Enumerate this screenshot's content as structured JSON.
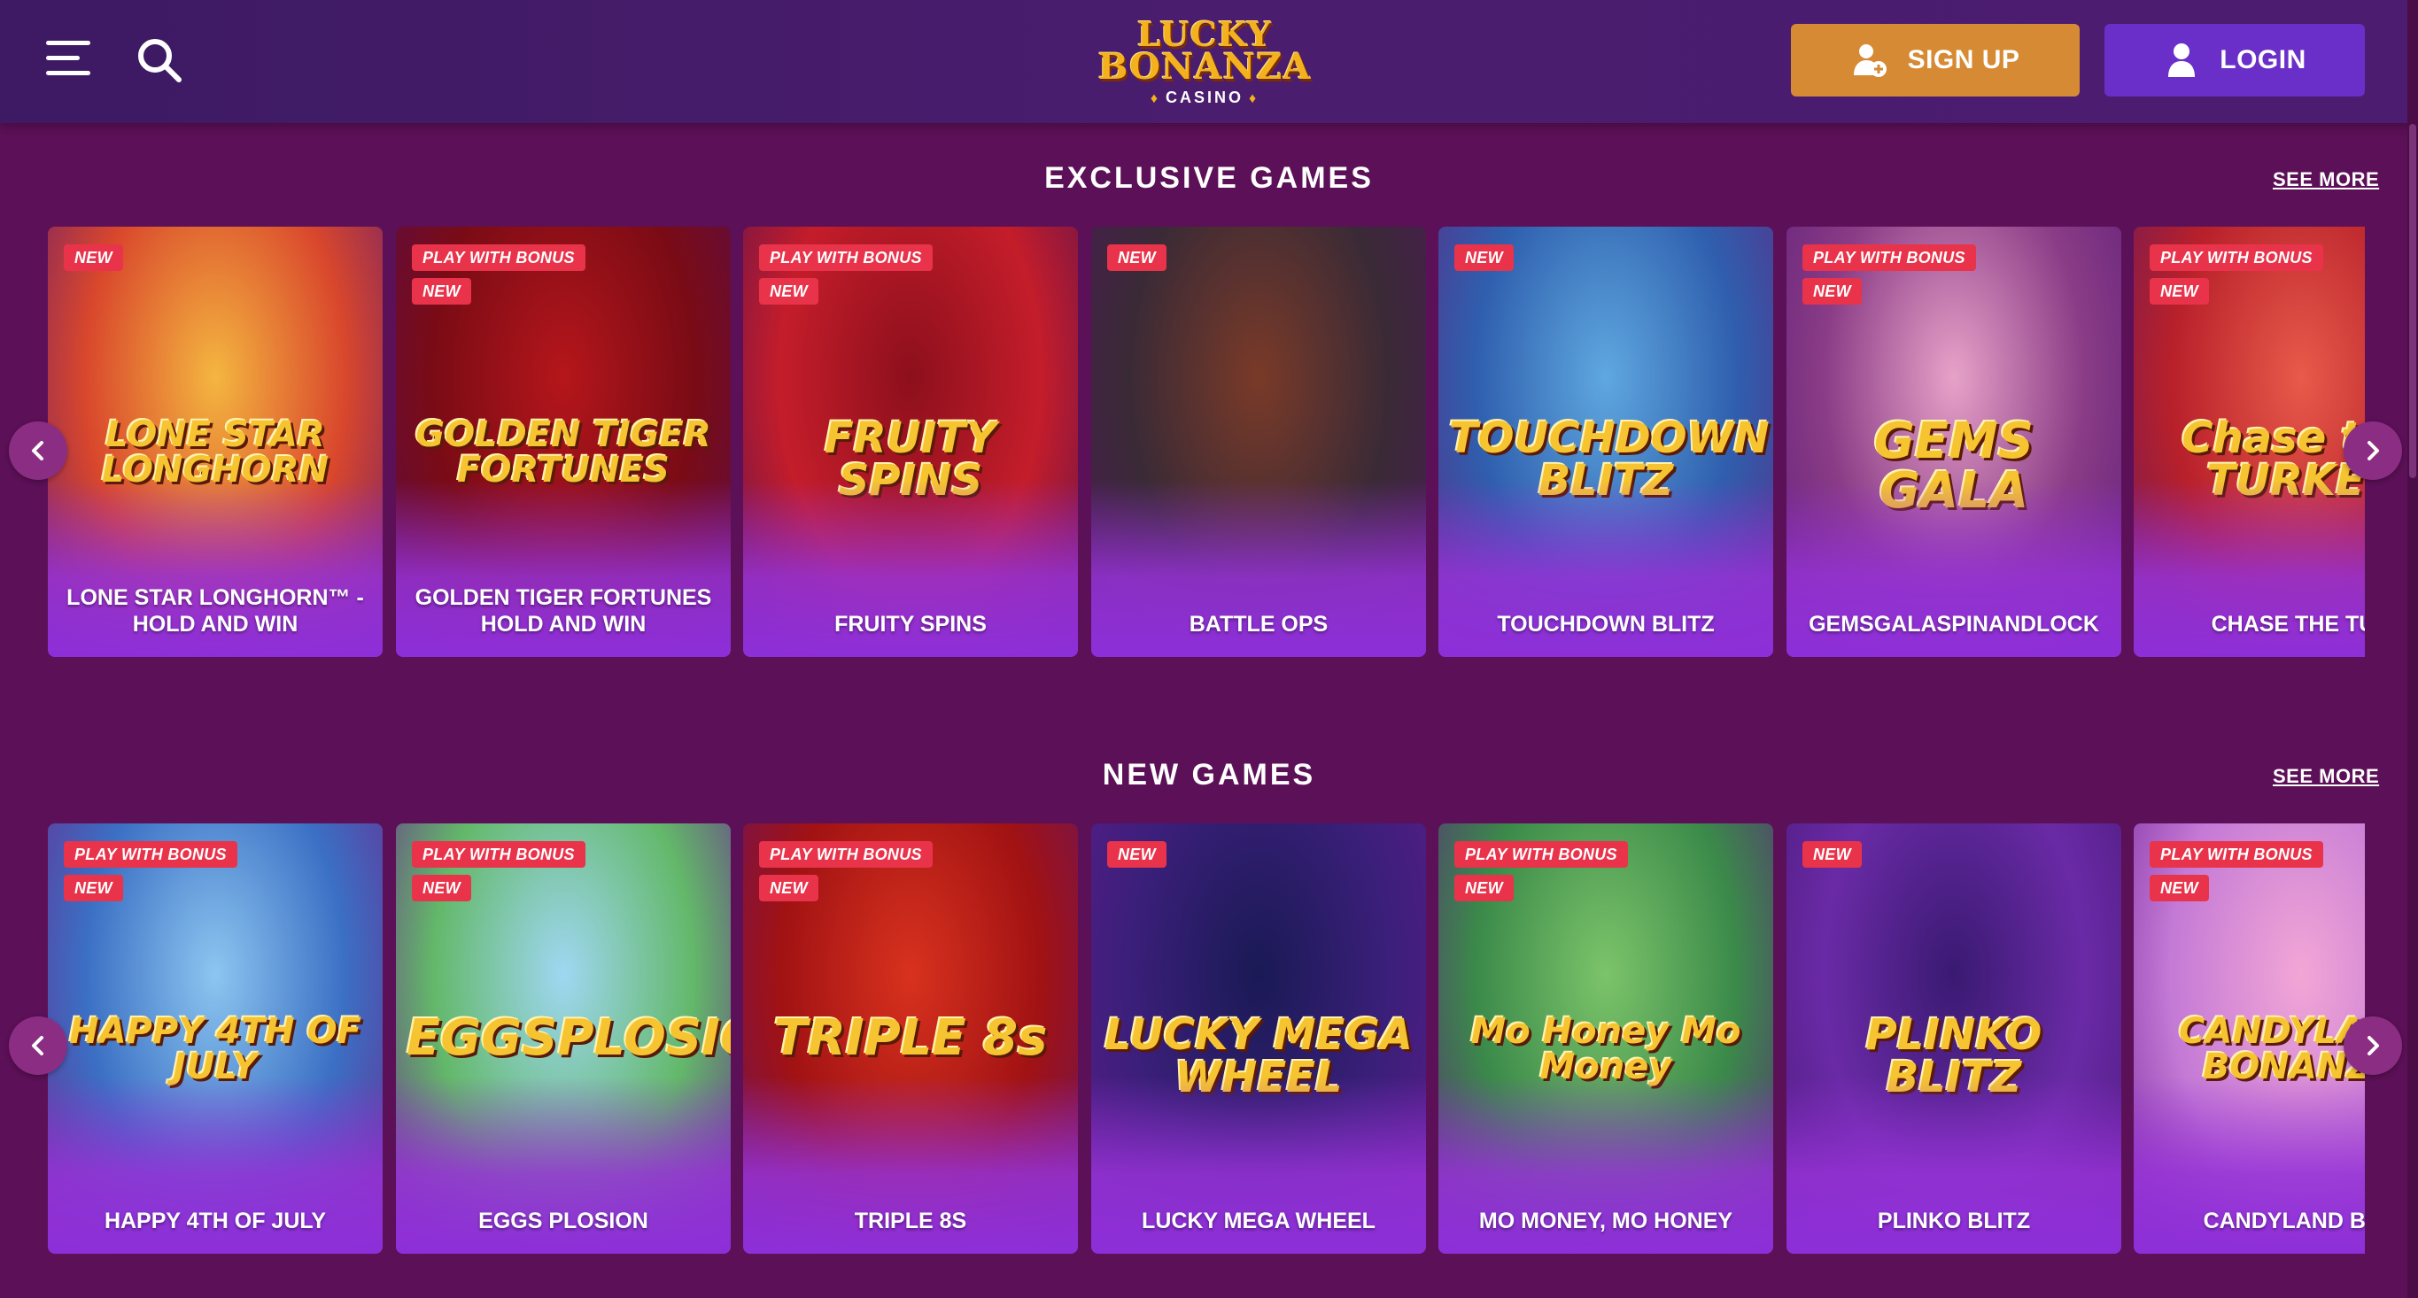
{
  "header": {
    "logo": {
      "line1": "LUCKY",
      "line2": "BONANZA",
      "line3": "CASINO"
    },
    "signup_label": "SIGN UP",
    "login_label": "LOGIN"
  },
  "sections": [
    {
      "title": "EXCLUSIVE GAMES",
      "see_more": "SEE MORE",
      "games": [
        {
          "name": "LONE STAR LONGHORN™ - HOLD AND WIN",
          "badges": [
            "NEW"
          ],
          "logo": "LONE STAR LONGHORN",
          "colors": [
            "#f4b640",
            "#d9472c",
            "#6d1d6a"
          ]
        },
        {
          "name": "GOLDEN TIGER FORTUNES HOLD AND WIN",
          "badges": [
            "PLAY WITH BONUS",
            "NEW"
          ],
          "logo": "GOLDEN TIGER FORTUNES",
          "colors": [
            "#b5161b",
            "#7a0b15",
            "#5a0e4a"
          ]
        },
        {
          "name": "FRUITY SPINS",
          "badges": [
            "PLAY WITH BONUS",
            "NEW"
          ],
          "logo": "FRUITY SPINS",
          "colors": [
            "#8d0f1c",
            "#c41d2a",
            "#5e124f"
          ]
        },
        {
          "name": "BATTLE OPS",
          "badges": [
            "NEW"
          ],
          "logo": "",
          "colors": [
            "#7a3a28",
            "#3a2a36",
            "#4b1a55"
          ]
        },
        {
          "name": "TOUCHDOWN BLITZ",
          "badges": [
            "NEW"
          ],
          "logo": "TOUCHDOWN BLITZ",
          "colors": [
            "#5fa8e0",
            "#2f5fae",
            "#5a2c86"
          ]
        },
        {
          "name": "GEMSGALASPINANDLOCK",
          "badges": [
            "PLAY WITH BONUS",
            "NEW"
          ],
          "logo": "GEMS GALA",
          "colors": [
            "#e7a2c8",
            "#8a3c86",
            "#5e1e7a"
          ]
        },
        {
          "name": "CHASE THE TUR",
          "badges": [
            "PLAY WITH BONUS",
            "NEW"
          ],
          "logo": "Chase the TURKEY",
          "colors": [
            "#e85a4a",
            "#b8202a",
            "#6a1a5a"
          ]
        }
      ]
    },
    {
      "title": "NEW GAMES",
      "see_more": "SEE MORE",
      "games": [
        {
          "name": "HAPPY 4TH OF JULY",
          "badges": [
            "PLAY WITH BONUS",
            "NEW"
          ],
          "logo": "HAPPY 4TH OF JULY",
          "colors": [
            "#8cc6f0",
            "#3b6fc4",
            "#6a2a8e"
          ]
        },
        {
          "name": "EGGS PLOSION",
          "badges": [
            "PLAY WITH BONUS",
            "NEW"
          ],
          "logo": "EGGSPLOSION",
          "colors": [
            "#9fd7f2",
            "#63b86a",
            "#6b2d8e"
          ]
        },
        {
          "name": "TRIPLE 8S",
          "badges": [
            "PLAY WITH BONUS",
            "NEW"
          ],
          "logo": "TRIPLE 8s",
          "colors": [
            "#d8321e",
            "#a11213",
            "#6a1460"
          ]
        },
        {
          "name": "LUCKY MEGA WHEEL",
          "badges": [
            "NEW"
          ],
          "logo": "LUCKY MEGA WHEEL",
          "colors": [
            "#1a1a55",
            "#3b1f7a",
            "#5b1d8a"
          ]
        },
        {
          "name": "MO MONEY, MO HONEY",
          "badges": [
            "PLAY WITH BONUS",
            "NEW"
          ],
          "logo": "Mo Honey Mo Money",
          "colors": [
            "#7cc46a",
            "#3b8a4a",
            "#5a2a7a"
          ]
        },
        {
          "name": "PLINKO BLITZ",
          "badges": [
            "NEW"
          ],
          "logo": "PLINKO BLITZ",
          "colors": [
            "#3a1a72",
            "#6a2aa6",
            "#4b1a7a"
          ]
        },
        {
          "name": "CANDYLAND BON",
          "badges": [
            "PLAY WITH BONUS",
            "NEW"
          ],
          "logo": "CANDYLAND BONANZA",
          "colors": [
            "#f2a6d6",
            "#c47ad6",
            "#7a2a9e"
          ]
        }
      ]
    }
  ]
}
